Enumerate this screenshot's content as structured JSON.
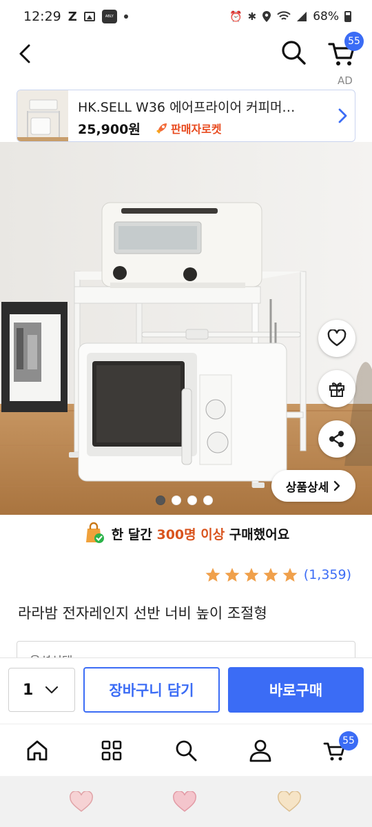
{
  "status_bar": {
    "time": "12:29",
    "z_label": "Z",
    "app_label": "ABLY",
    "battery": "68%"
  },
  "header": {
    "cart_count": "55"
  },
  "ad": {
    "label": "AD",
    "title": "HK.SELL W36 에어프라이어 커피머…",
    "price": "25,900원",
    "badge": "판매자로켓"
  },
  "product_image": {
    "slide_count": 4,
    "active_slide": 0
  },
  "actions": {
    "detail_label": "상품상세"
  },
  "notice": {
    "prefix": "한 달간 ",
    "highlight": "300명 이상",
    "suffix": " 구매했어요"
  },
  "rating": {
    "stars": 5,
    "count": "(1,359)",
    "star_color": "#f0a04b"
  },
  "product": {
    "title": "라라밤 전자레인지 선반 너비 높이 조절형"
  },
  "option": {
    "placeholder": "옵션선택"
  },
  "purchase": {
    "quantity": "1",
    "cart_label": "장바구니 담기",
    "buy_label": "바로구매"
  },
  "bottom_nav": {
    "cart_count": "55"
  },
  "colors": {
    "accent": "#3b6cf5",
    "highlight": "#d9541e"
  }
}
